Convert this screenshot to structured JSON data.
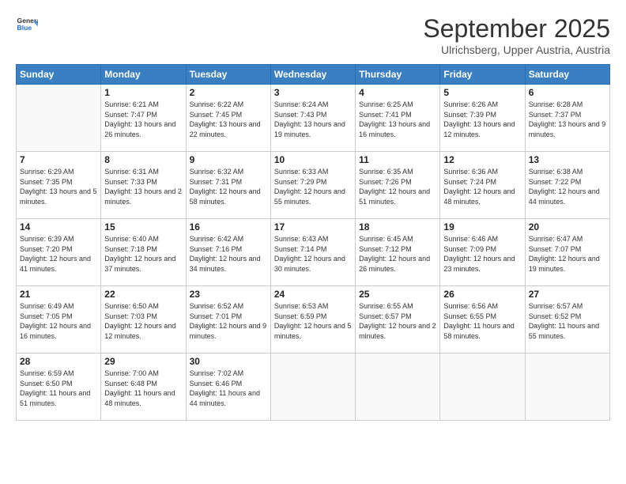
{
  "header": {
    "logo_general": "General",
    "logo_blue": "Blue",
    "month_title": "September 2025",
    "subtitle": "Ulrichsberg, Upper Austria, Austria"
  },
  "days_of_week": [
    "Sunday",
    "Monday",
    "Tuesday",
    "Wednesday",
    "Thursday",
    "Friday",
    "Saturday"
  ],
  "weeks": [
    [
      {
        "day": "",
        "sunrise": "",
        "sunset": "",
        "daylight": ""
      },
      {
        "day": "1",
        "sunrise": "Sunrise: 6:21 AM",
        "sunset": "Sunset: 7:47 PM",
        "daylight": "Daylight: 13 hours and 26 minutes."
      },
      {
        "day": "2",
        "sunrise": "Sunrise: 6:22 AM",
        "sunset": "Sunset: 7:45 PM",
        "daylight": "Daylight: 13 hours and 22 minutes."
      },
      {
        "day": "3",
        "sunrise": "Sunrise: 6:24 AM",
        "sunset": "Sunset: 7:43 PM",
        "daylight": "Daylight: 13 hours and 19 minutes."
      },
      {
        "day": "4",
        "sunrise": "Sunrise: 6:25 AM",
        "sunset": "Sunset: 7:41 PM",
        "daylight": "Daylight: 13 hours and 16 minutes."
      },
      {
        "day": "5",
        "sunrise": "Sunrise: 6:26 AM",
        "sunset": "Sunset: 7:39 PM",
        "daylight": "Daylight: 13 hours and 12 minutes."
      },
      {
        "day": "6",
        "sunrise": "Sunrise: 6:28 AM",
        "sunset": "Sunset: 7:37 PM",
        "daylight": "Daylight: 13 hours and 9 minutes."
      }
    ],
    [
      {
        "day": "7",
        "sunrise": "Sunrise: 6:29 AM",
        "sunset": "Sunset: 7:35 PM",
        "daylight": "Daylight: 13 hours and 5 minutes."
      },
      {
        "day": "8",
        "sunrise": "Sunrise: 6:31 AM",
        "sunset": "Sunset: 7:33 PM",
        "daylight": "Daylight: 13 hours and 2 minutes."
      },
      {
        "day": "9",
        "sunrise": "Sunrise: 6:32 AM",
        "sunset": "Sunset: 7:31 PM",
        "daylight": "Daylight: 12 hours and 58 minutes."
      },
      {
        "day": "10",
        "sunrise": "Sunrise: 6:33 AM",
        "sunset": "Sunset: 7:29 PM",
        "daylight": "Daylight: 12 hours and 55 minutes."
      },
      {
        "day": "11",
        "sunrise": "Sunrise: 6:35 AM",
        "sunset": "Sunset: 7:26 PM",
        "daylight": "Daylight: 12 hours and 51 minutes."
      },
      {
        "day": "12",
        "sunrise": "Sunrise: 6:36 AM",
        "sunset": "Sunset: 7:24 PM",
        "daylight": "Daylight: 12 hours and 48 minutes."
      },
      {
        "day": "13",
        "sunrise": "Sunrise: 6:38 AM",
        "sunset": "Sunset: 7:22 PM",
        "daylight": "Daylight: 12 hours and 44 minutes."
      }
    ],
    [
      {
        "day": "14",
        "sunrise": "Sunrise: 6:39 AM",
        "sunset": "Sunset: 7:20 PM",
        "daylight": "Daylight: 12 hours and 41 minutes."
      },
      {
        "day": "15",
        "sunrise": "Sunrise: 6:40 AM",
        "sunset": "Sunset: 7:18 PM",
        "daylight": "Daylight: 12 hours and 37 minutes."
      },
      {
        "day": "16",
        "sunrise": "Sunrise: 6:42 AM",
        "sunset": "Sunset: 7:16 PM",
        "daylight": "Daylight: 12 hours and 34 minutes."
      },
      {
        "day": "17",
        "sunrise": "Sunrise: 6:43 AM",
        "sunset": "Sunset: 7:14 PM",
        "daylight": "Daylight: 12 hours and 30 minutes."
      },
      {
        "day": "18",
        "sunrise": "Sunrise: 6:45 AM",
        "sunset": "Sunset: 7:12 PM",
        "daylight": "Daylight: 12 hours and 26 minutes."
      },
      {
        "day": "19",
        "sunrise": "Sunrise: 6:46 AM",
        "sunset": "Sunset: 7:09 PM",
        "daylight": "Daylight: 12 hours and 23 minutes."
      },
      {
        "day": "20",
        "sunrise": "Sunrise: 6:47 AM",
        "sunset": "Sunset: 7:07 PM",
        "daylight": "Daylight: 12 hours and 19 minutes."
      }
    ],
    [
      {
        "day": "21",
        "sunrise": "Sunrise: 6:49 AM",
        "sunset": "Sunset: 7:05 PM",
        "daylight": "Daylight: 12 hours and 16 minutes."
      },
      {
        "day": "22",
        "sunrise": "Sunrise: 6:50 AM",
        "sunset": "Sunset: 7:03 PM",
        "daylight": "Daylight: 12 hours and 12 minutes."
      },
      {
        "day": "23",
        "sunrise": "Sunrise: 6:52 AM",
        "sunset": "Sunset: 7:01 PM",
        "daylight": "Daylight: 12 hours and 9 minutes."
      },
      {
        "day": "24",
        "sunrise": "Sunrise: 6:53 AM",
        "sunset": "Sunset: 6:59 PM",
        "daylight": "Daylight: 12 hours and 5 minutes."
      },
      {
        "day": "25",
        "sunrise": "Sunrise: 6:55 AM",
        "sunset": "Sunset: 6:57 PM",
        "daylight": "Daylight: 12 hours and 2 minutes."
      },
      {
        "day": "26",
        "sunrise": "Sunrise: 6:56 AM",
        "sunset": "Sunset: 6:55 PM",
        "daylight": "Daylight: 11 hours and 58 minutes."
      },
      {
        "day": "27",
        "sunrise": "Sunrise: 6:57 AM",
        "sunset": "Sunset: 6:52 PM",
        "daylight": "Daylight: 11 hours and 55 minutes."
      }
    ],
    [
      {
        "day": "28",
        "sunrise": "Sunrise: 6:59 AM",
        "sunset": "Sunset: 6:50 PM",
        "daylight": "Daylight: 11 hours and 51 minutes."
      },
      {
        "day": "29",
        "sunrise": "Sunrise: 7:00 AM",
        "sunset": "Sunset: 6:48 PM",
        "daylight": "Daylight: 11 hours and 48 minutes."
      },
      {
        "day": "30",
        "sunrise": "Sunrise: 7:02 AM",
        "sunset": "Sunset: 6:46 PM",
        "daylight": "Daylight: 11 hours and 44 minutes."
      },
      {
        "day": "",
        "sunrise": "",
        "sunset": "",
        "daylight": ""
      },
      {
        "day": "",
        "sunrise": "",
        "sunset": "",
        "daylight": ""
      },
      {
        "day": "",
        "sunrise": "",
        "sunset": "",
        "daylight": ""
      },
      {
        "day": "",
        "sunrise": "",
        "sunset": "",
        "daylight": ""
      }
    ]
  ]
}
